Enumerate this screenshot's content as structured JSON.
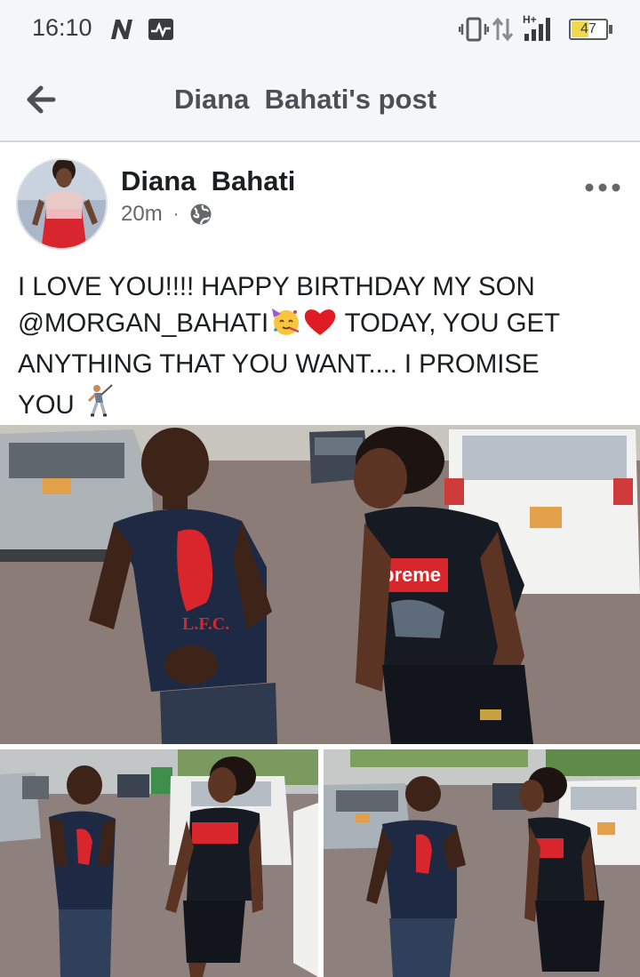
{
  "status_bar": {
    "time": "16:10",
    "battery_level": "47",
    "icons": [
      "n-icon",
      "activity-icon",
      "vibrate-icon",
      "data-arrows-icon",
      "signal-icon",
      "battery-icon"
    ]
  },
  "header": {
    "title": "Diana  Bahati's post",
    "back_icon": "arrow-left-icon"
  },
  "post": {
    "author": "Diana  Bahati",
    "time_ago": "20m",
    "separator": "·",
    "privacy_icon": "globe-icon",
    "more_icon": "more-horizontal-icon",
    "text_parts": {
      "line1": "I LOVE YOU!!!! HAPPY BIRTHDAY MY SON",
      "mention": "@MORGAN_BAHATI",
      "line2b": " TODAY, YOU GET",
      "line3": "ANYTHING THAT YOU WANT.... I PROMISE",
      "line4": "YOU"
    },
    "emojis": [
      "party-face-emoji",
      "red-heart-emoji",
      "man-golfing-emoji"
    ],
    "photos": [
      "photo-main",
      "photo-bottom-left",
      "photo-bottom-right"
    ]
  },
  "colors": {
    "background": "#ffffff",
    "header_bg": "#f5f6f7",
    "text": "#1c1e21",
    "secondary_text": "#65676b",
    "title_text": "#4b4f56",
    "jersey_red": "#d8262c"
  }
}
